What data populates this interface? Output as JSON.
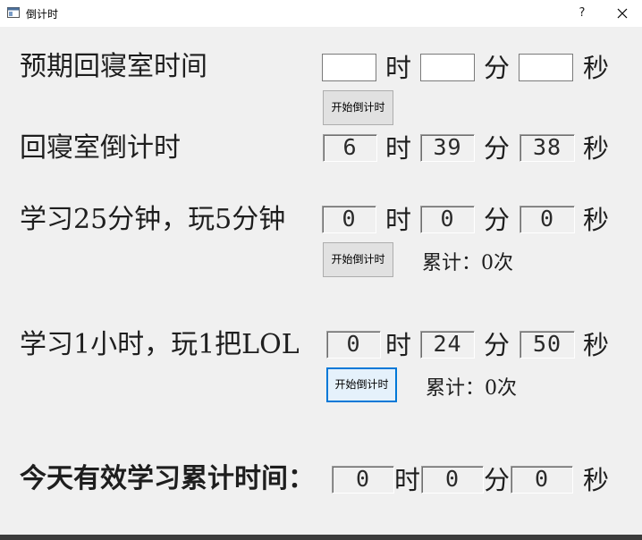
{
  "window": {
    "title": "倒计时",
    "help_label": "?"
  },
  "rows": {
    "expected": {
      "label": "预期回寝室时间",
      "hours": "",
      "minutes": "",
      "seconds": "",
      "button_label": "开始倒计时"
    },
    "countdown": {
      "label": "回寝室倒计时",
      "hours": "6",
      "minutes": "39",
      "seconds": "38"
    },
    "pomodoro": {
      "label": "学习25分钟，玩5分钟",
      "hours": "0",
      "minutes": "0",
      "seconds": "0",
      "button_label": "开始倒计时",
      "count_text": "累计：0次"
    },
    "lol": {
      "label": "学习1小时，玩1把LOL",
      "hours": "0",
      "minutes": "24",
      "seconds": "50",
      "button_label": "开始倒计时",
      "count_text": "累计：0次"
    },
    "total": {
      "label": "今天有效学习累计时间：",
      "hours": "0",
      "minutes": "0",
      "seconds": "0"
    }
  },
  "units": {
    "hour": "时",
    "minute": "分",
    "second": "秒"
  }
}
